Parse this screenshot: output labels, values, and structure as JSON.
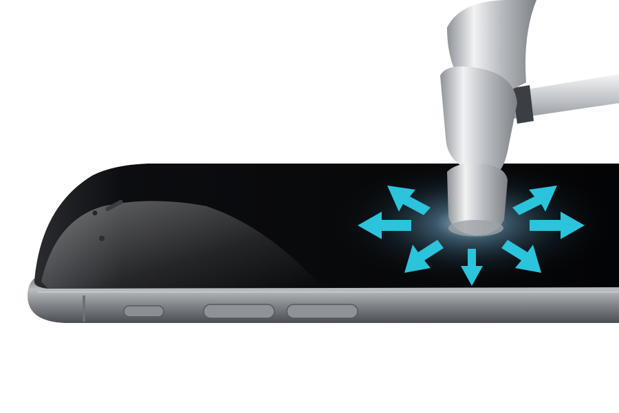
{
  "scene": {
    "subject": "tempered-glass-screen-protector",
    "background_color": "#ffffff",
    "phone_body_color": "#7d8185",
    "phone_screen_color": "#050608",
    "arrow_color": "#2cc3dc",
    "hammer_color": "#c9ccd0",
    "icons": [
      "phone",
      "hammer",
      "impact-arrows",
      "speaker-grille",
      "front-camera",
      "volume-buttons",
      "mute-switch"
    ]
  }
}
